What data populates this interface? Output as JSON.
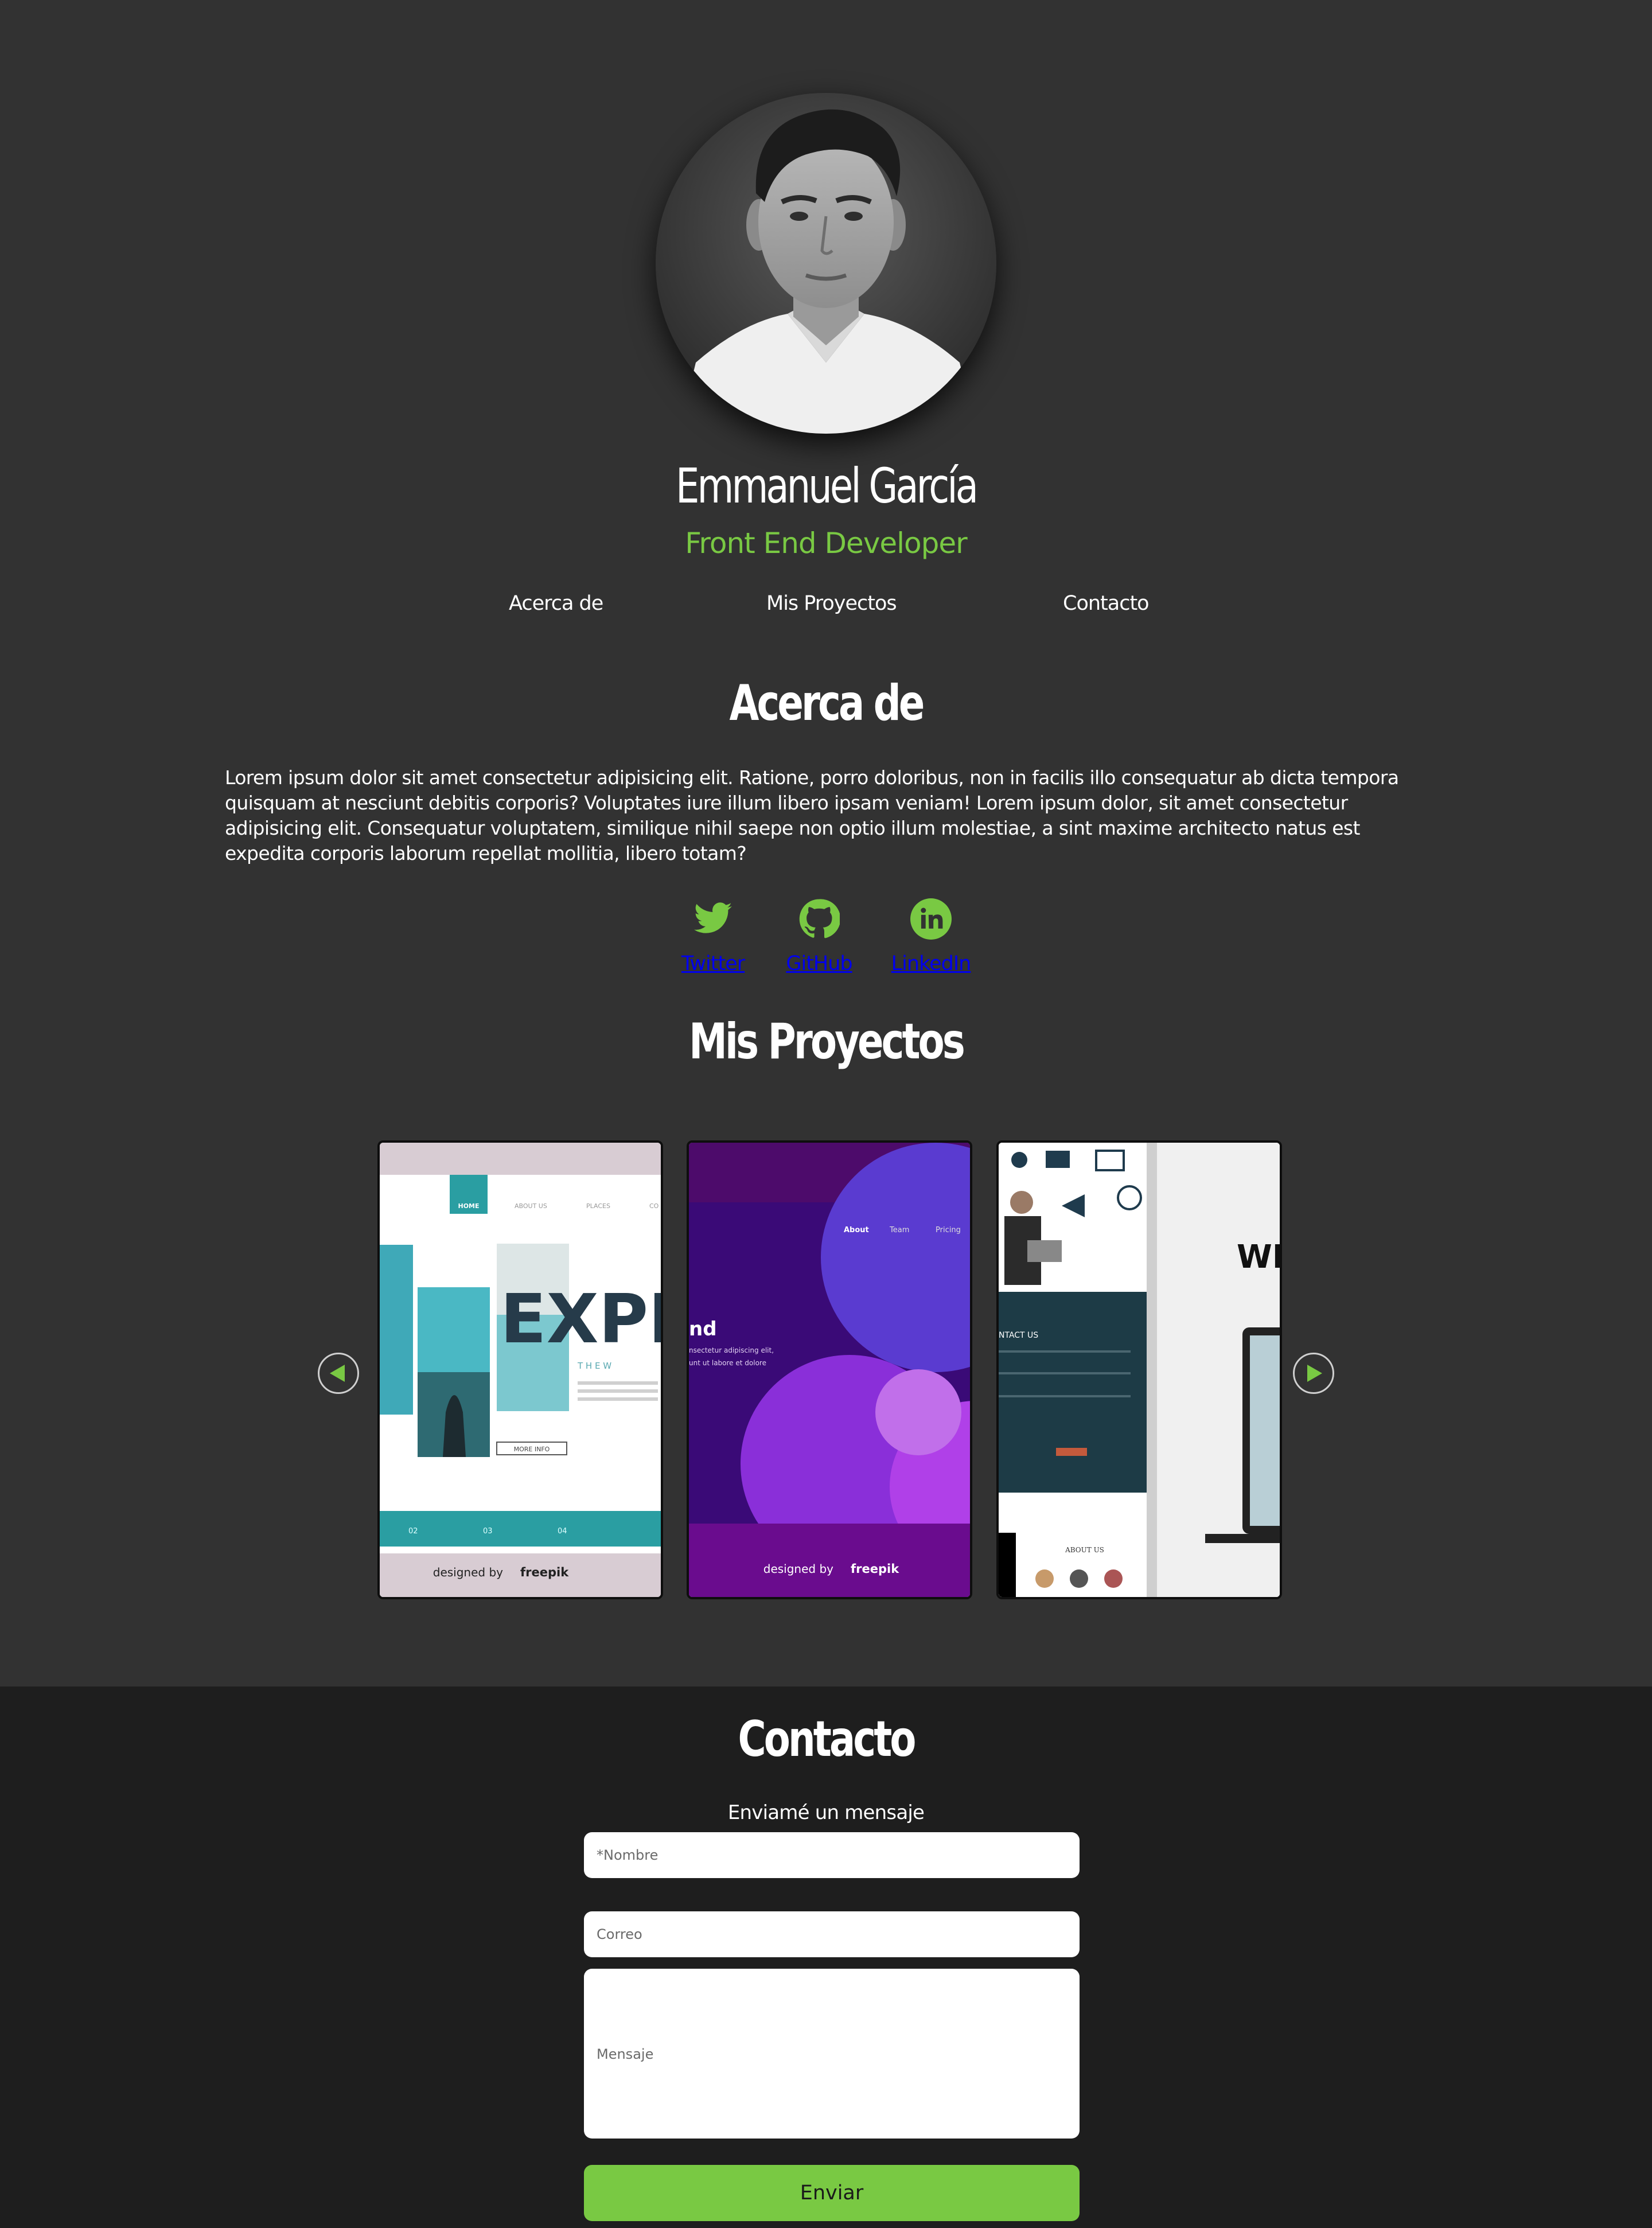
{
  "profile": {
    "name": "Emmanuel García",
    "role": "Front End Developer"
  },
  "nav": {
    "items": [
      "Acerca de",
      "Mis Proyectos",
      "Contacto"
    ]
  },
  "about": {
    "title": "Acerca de",
    "text": "Lorem ipsum dolor sit amet consectetur adipisicing elit. Ratione, porro doloribus, non in facilis illo consequatur ab dicta tempora quisquam at nesciunt debitis corporis? Voluptates iure illum libero ipsam veniam! Lorem ipsum dolor, sit amet consectetur adipisicing elit. Consequatur voluptatem, similique nihil saepe non optio illum molestiae, a sint maxime architecto natus est expedita corporis laborum repellat mollitia, libero totam?"
  },
  "social": [
    {
      "label": "Twitter",
      "icon": "twitter-icon"
    },
    {
      "label": "GitHub",
      "icon": "github-icon"
    },
    {
      "label": "LinkedIn",
      "icon": "linkedin-icon"
    }
  ],
  "projects": {
    "title": "Mis Proyectos",
    "cards": [
      {
        "nav": [
          "HOME",
          "ABOUT US",
          "PLACES",
          "CO"
        ],
        "headline": "EXPLO",
        "tagline": "T H E  W",
        "button": "MORE INFO",
        "pages": [
          "02",
          "03",
          "04"
        ],
        "credit": "designed by",
        "brand": "freepik"
      },
      {
        "nav": [
          "About",
          "Team",
          "Pricing"
        ],
        "headline": "nd",
        "body_lines": [
          "nsectetur adipiscing elit,",
          "unt ut labore et dolore"
        ],
        "credit": "designed by",
        "brand": "freepik"
      },
      {
        "contact": "NTACT US",
        "about": "ABOUT US",
        "headline": "WI"
      }
    ]
  },
  "contact": {
    "title": "Contacto",
    "subtitle": "Enviamé un mensaje",
    "name_placeholder": "*Nombre",
    "email_placeholder": "Correo",
    "message_placeholder": "Mensaje",
    "submit_label": "Enviar"
  },
  "colors": {
    "accent": "#79c943",
    "background": "#323232",
    "footer_background": "#1e1e1e"
  }
}
